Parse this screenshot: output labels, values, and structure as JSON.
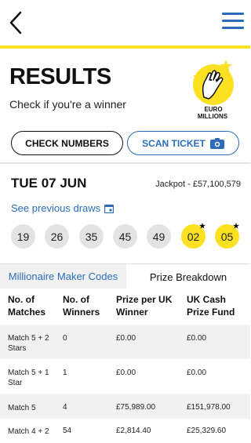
{
  "header": {
    "menu_color": "#2c6cb6",
    "accent_color": "#fbe122"
  },
  "page": {
    "title": "RESULTS",
    "subtitle": "Check if you're a winner",
    "logo_text_line1": "EURO",
    "logo_text_line2": "MILLIONS"
  },
  "actions": {
    "check_label": "CHECK NUMBERS",
    "scan_label": "SCAN TICKET"
  },
  "draw": {
    "date": "TUE 07 JUN",
    "jackpot": "Jackpot - £57,100,579",
    "previous_link": "See previous draws",
    "balls": [
      "19",
      "26",
      "35",
      "45",
      "49"
    ],
    "lucky_stars": [
      "02",
      "05"
    ]
  },
  "tabs": {
    "millionaire": "Millionaire Maker Codes",
    "prize": "Prize Breakdown"
  },
  "table": {
    "headers": [
      "No. of Matches",
      "No. of Winners",
      "Prize per UK Winner",
      "UK Cash Prize Fund"
    ],
    "rows": [
      [
        "Match 5 + 2 Stars",
        "0",
        "£0.00",
        "£0.00"
      ],
      [
        "Match 5 + 1 Star",
        "1",
        "£0.00",
        "£0.00"
      ],
      [
        "Match 5",
        "4",
        "£75,989.00",
        "£151,978.00"
      ],
      [
        "Match 4 + 2",
        "54",
        "£2,814.40",
        "£25,329.60"
      ]
    ]
  }
}
